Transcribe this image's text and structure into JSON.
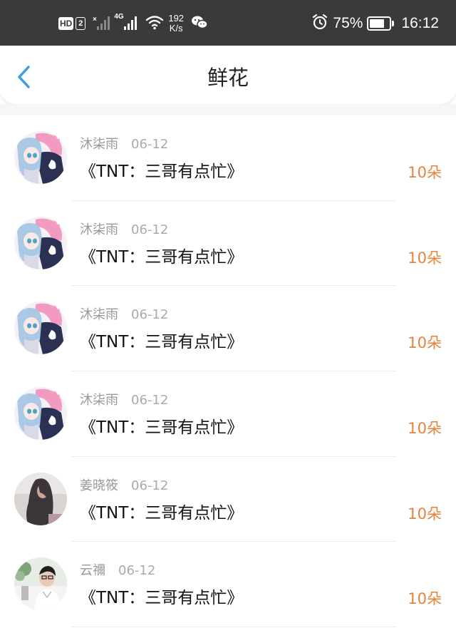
{
  "status_bar": {
    "hd_label": "HD",
    "sim_label": "2",
    "network_label": "4G",
    "speed_value": "192",
    "speed_unit": "K/s",
    "battery_percent": "75%",
    "battery_level": 0.75,
    "time": "16:12",
    "icons": [
      "no-signal-icon",
      "signal-icon",
      "wifi-icon",
      "wechat-icon",
      "alarm-icon",
      "battery-icon"
    ]
  },
  "nav": {
    "title": "鲜花",
    "back_icon": "chevron-left-icon"
  },
  "colors": {
    "accent_blue": "#3a9be6",
    "amount_orange": "#e8823a",
    "status_bar_bg": "#3a3a3a"
  },
  "records": [
    {
      "name": "沐柒雨",
      "date": "06-12",
      "work": "《TNT：三哥有点忙》",
      "amount": "10朵",
      "avatar": "anime"
    },
    {
      "name": "沐柒雨",
      "date": "06-12",
      "work": "《TNT：三哥有点忙》",
      "amount": "10朵",
      "avatar": "anime"
    },
    {
      "name": "沐柒雨",
      "date": "06-12",
      "work": "《TNT：三哥有点忙》",
      "amount": "10朵",
      "avatar": "anime"
    },
    {
      "name": "沐柒雨",
      "date": "06-12",
      "work": "《TNT：三哥有点忙》",
      "amount": "10朵",
      "avatar": "anime"
    },
    {
      "name": "姜晓筱",
      "date": "06-12",
      "work": "《TNT：三哥有点忙》",
      "amount": "10朵",
      "avatar": "photo-girl"
    },
    {
      "name": "云禰",
      "date": "06-12",
      "work": "《TNT：三哥有点忙》",
      "amount": "10朵",
      "avatar": "photo-boy"
    }
  ]
}
